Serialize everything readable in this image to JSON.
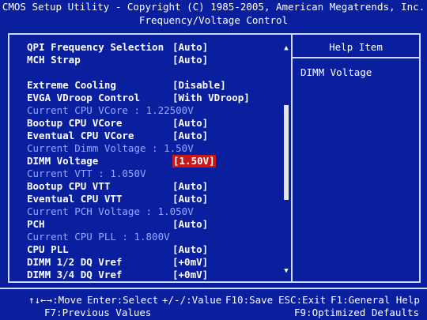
{
  "header": {
    "title": "CMOS Setup Utility - Copyright (C) 1985-2005, American Megatrends, Inc.",
    "subtitle": "Frequency/Voltage Control"
  },
  "settings": {
    "qpi_frequency": {
      "label": "QPI Frequency Selection",
      "value": "[Auto]"
    },
    "mch_strap": {
      "label": "MCH Strap",
      "value": "[Auto]"
    },
    "extreme_cooling": {
      "label": "Extreme Cooling",
      "value": "[Disable]"
    },
    "evga_vdroop": {
      "label": "EVGA VDroop Control",
      "value": "[With VDroop]"
    },
    "current_cpu_vcore": "Current CPU VCore : 1.22500V",
    "bootup_cpu_vcore": {
      "label": "Bootup CPU VCore",
      "value": "[Auto]"
    },
    "eventual_cpu_vcore": {
      "label": "Eventual CPU VCore",
      "value": "[Auto]"
    },
    "current_dimm_voltage": "Current Dimm Voltage : 1.50V",
    "dimm_voltage": {
      "label": "DIMM Voltage",
      "value": "[1.50V]"
    },
    "current_vtt": "Current VTT : 1.050V",
    "bootup_cpu_vtt": {
      "label": "Bootup CPU VTT",
      "value": "[Auto]"
    },
    "eventual_cpu_vtt": {
      "label": "Eventual CPU VTT",
      "value": "[Auto]"
    },
    "current_pch_voltage": "Current PCH Voltage : 1.050V",
    "pch": {
      "label": "PCH",
      "value": "[Auto]"
    },
    "current_cpu_pll": "Current CPU PLL : 1.800V",
    "cpu_pll": {
      "label": "CPU PLL",
      "value": "[Auto]"
    },
    "dimm_12_dq_vref": {
      "label": "DIMM 1/2 DQ Vref",
      "value": "[+0mV]"
    },
    "dimm_34_dq_vref": {
      "label": "DIMM 3/4 DQ Vref",
      "value": "[+0mV]"
    }
  },
  "help": {
    "title": "Help Item",
    "text": "DIMM Voltage"
  },
  "footer": {
    "move": "↑↓←→:Move",
    "enter": "Enter:Select",
    "value": "+/-/:Value",
    "save": "F10:Save",
    "exit": "ESC:Exit",
    "general_help": "F1:General Help",
    "previous": "F7:Previous Values",
    "optimized": "F9:Optimized Defaults"
  },
  "scroll": {
    "up": "▲",
    "down": "▼"
  },
  "colors": {
    "background": "#0a1f9e",
    "text": "#ffffff",
    "info_text": "#9aa8ff",
    "selected_bg": "#c81818"
  }
}
